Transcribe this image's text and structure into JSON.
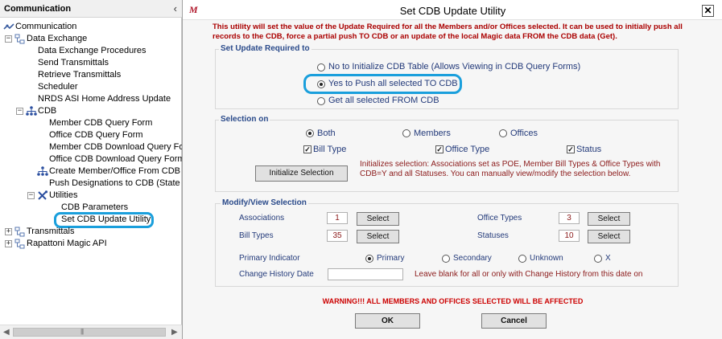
{
  "sidebar": {
    "title": "Communication",
    "collapse_glyph": "‹",
    "root": "Communication",
    "items": [
      {
        "label": "Data Exchange",
        "toggle": "−",
        "icon": "tree-nodes-icon"
      },
      {
        "label": "Data Exchange Procedures"
      },
      {
        "label": "Send Transmittals"
      },
      {
        "label": "Retrieve Transmittals"
      },
      {
        "label": "Scheduler"
      },
      {
        "label": "NRDS ASI Home Address Update"
      },
      {
        "label": "CDB",
        "toggle": "−",
        "icon": "hierarchy-icon"
      },
      {
        "label": "Member CDB Query Form"
      },
      {
        "label": "Office CDB Query Form"
      },
      {
        "label": "Member CDB Download Query Form"
      },
      {
        "label": "Office CDB Download Query Form"
      },
      {
        "label": "Create Member/Office From CDB",
        "icon": "hierarchy-icon"
      },
      {
        "label": "Push Designations to CDB (State only)"
      },
      {
        "label": "Utilities",
        "toggle": "−",
        "icon": "tools-icon"
      },
      {
        "label": "CDB Parameters"
      },
      {
        "label": "Set CDB Update Utility",
        "selected": true
      },
      {
        "label": "Transmittals",
        "toggle": "+",
        "icon": "tree-nodes-icon"
      },
      {
        "label": "Rapattoni Magic API",
        "toggle": "+",
        "icon": "tree-nodes-icon"
      }
    ]
  },
  "dialog": {
    "logo": "M",
    "title": "Set CDB Update Utility",
    "close": "✕",
    "intro": "This utility will set the value of the Update Required for all the Members and/or Offices selected. It can be used to initially push all records to the CDB, force a partial push TO CDB or an update of the local Magic data FROM the CDB data (Get).",
    "set_update": {
      "legend": "Set Update Required to",
      "options": [
        {
          "label": "No to Initialize CDB Table (Allows Viewing in CDB Query Forms)",
          "selected": false
        },
        {
          "label": "Yes to Push all selected TO CDB",
          "selected": true
        },
        {
          "label": "Get all selected FROM CDB",
          "selected": false
        }
      ]
    },
    "selection": {
      "legend": "Selection on",
      "radios": [
        {
          "label": "Both",
          "selected": true
        },
        {
          "label": "Members",
          "selected": false
        },
        {
          "label": "Offices",
          "selected": false
        }
      ],
      "checks": [
        {
          "label": "Bill Type",
          "checked": true
        },
        {
          "label": "Office Type",
          "checked": true
        },
        {
          "label": "Status",
          "checked": true
        }
      ],
      "init_button": "Initialize Selection",
      "note": "Initializes selection: Associations set as POE, Member Bill Types & Office Types with CDB=Y and all Statuses. You can manually view/modify the selection below."
    },
    "modify": {
      "legend": "Modify/View Selection",
      "associations": {
        "label": "Associations",
        "value": "1",
        "button": "Select"
      },
      "bill_types": {
        "label": "Bill Types",
        "value": "35",
        "button": "Select"
      },
      "office_types": {
        "label": "Office Types",
        "value": "3",
        "button": "Select"
      },
      "statuses": {
        "label": "Statuses",
        "value": "10",
        "button": "Select"
      },
      "primary_indicator": {
        "label": "Primary Indicator",
        "options": [
          {
            "label": "Primary",
            "selected": true
          },
          {
            "label": "Secondary",
            "selected": false
          },
          {
            "label": "Unknown",
            "selected": false
          },
          {
            "label": "X",
            "selected": false
          }
        ]
      },
      "change_history": {
        "label": "Change History Date",
        "value": "",
        "note": "Leave blank for all or only with Change History from this date on"
      }
    },
    "warning": "WARNING!!! ALL MEMBERS AND OFFICES SELECTED WILL BE AFFECTED",
    "ok": "OK",
    "cancel": "Cancel"
  }
}
